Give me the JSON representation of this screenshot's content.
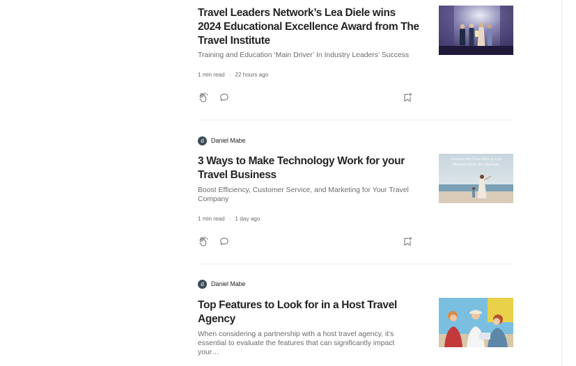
{
  "articles": [
    {
      "author": null,
      "title": "Travel Leaders Network’s Lea Diele wins 2024 Educational Excellence Award from The Travel Institute",
      "subtitle": "Training and Education ‘Main Driver’ In Industry Leaders’ Success",
      "read_time": "1 min read",
      "separator": "·",
      "posted": "22 hours ago"
    },
    {
      "author": {
        "initial": "d",
        "name": "Daniel Mabe"
      },
      "title": "3 Ways to Make Technology Work for your Travel Business",
      "subtitle": "Boost Efficiency, Customer Service, and Marketing for Your Travel Company",
      "read_time": "1 min read",
      "separator": "·",
      "posted": "1 day ago",
      "thumb_text": "3 Reasons Why Travel Advising is the",
      "thumb_script": "Perfect Path for Parents"
    },
    {
      "author": {
        "initial": "d",
        "name": "Daniel Mabe"
      },
      "title": "Top Features to Look for in a Host Travel Agency",
      "subtitle": "When considering a partnership with a host travel agency, it’s essential to evaluate the features that can significantly impact your…"
    }
  ],
  "icons": {
    "clap": "clap-icon",
    "response": "response-bubble-icon",
    "bookmark": "bookmark-add-icon"
  },
  "colors": {
    "text_primary": "#242424",
    "text_secondary": "#6b6b6b",
    "avatar_bg": "#3e4b57",
    "divider": "#f0f0f0"
  }
}
